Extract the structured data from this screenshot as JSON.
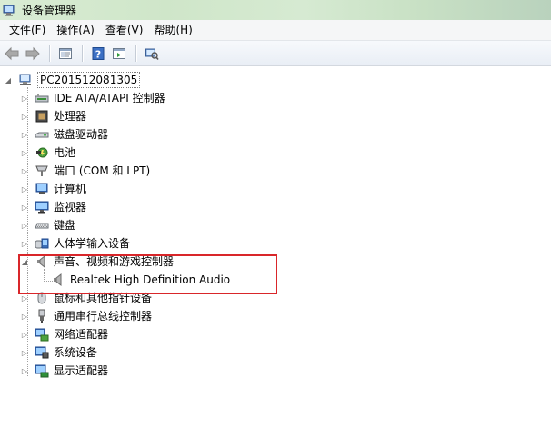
{
  "window": {
    "title": "设备管理器"
  },
  "menu": {
    "items": [
      "文件(F)",
      "操作(A)",
      "查看(V)",
      "帮助(H)"
    ]
  },
  "toolbar": {
    "buttons": [
      "back-arrow-icon",
      "forward-arrow-icon",
      "properties-pane-icon",
      "help-icon",
      "console-tree-icon",
      "scan-hardware-icon"
    ]
  },
  "tree": {
    "root": "PC201512081305",
    "categories": [
      {
        "label": "IDE ATA/ATAPI 控制器",
        "icon": "ide-controller-icon"
      },
      {
        "label": "处理器",
        "icon": "processor-icon"
      },
      {
        "label": "磁盘驱动器",
        "icon": "disk-drive-icon"
      },
      {
        "label": "电池",
        "icon": "battery-icon"
      },
      {
        "label": "端口 (COM 和 LPT)",
        "icon": "port-icon"
      },
      {
        "label": "计算机",
        "icon": "computer-icon"
      },
      {
        "label": "监视器",
        "icon": "monitor-icon"
      },
      {
        "label": "键盘",
        "icon": "keyboard-icon"
      },
      {
        "label": "人体学输入设备",
        "icon": "hid-icon"
      },
      {
        "label": "声音、视频和游戏控制器",
        "icon": "speaker-icon",
        "expanded": true
      },
      {
        "label": "鼠标和其他指针设备",
        "icon": "mouse-icon"
      },
      {
        "label": "通用串行总线控制器",
        "icon": "usb-icon"
      },
      {
        "label": "网络适配器",
        "icon": "network-adapter-icon"
      },
      {
        "label": "系统设备",
        "icon": "system-device-icon"
      },
      {
        "label": "显示适配器",
        "icon": "display-adapter-icon"
      }
    ],
    "child": "Realtek High Definition Audio"
  },
  "colors": {
    "highlight_border": "#d9262a"
  }
}
